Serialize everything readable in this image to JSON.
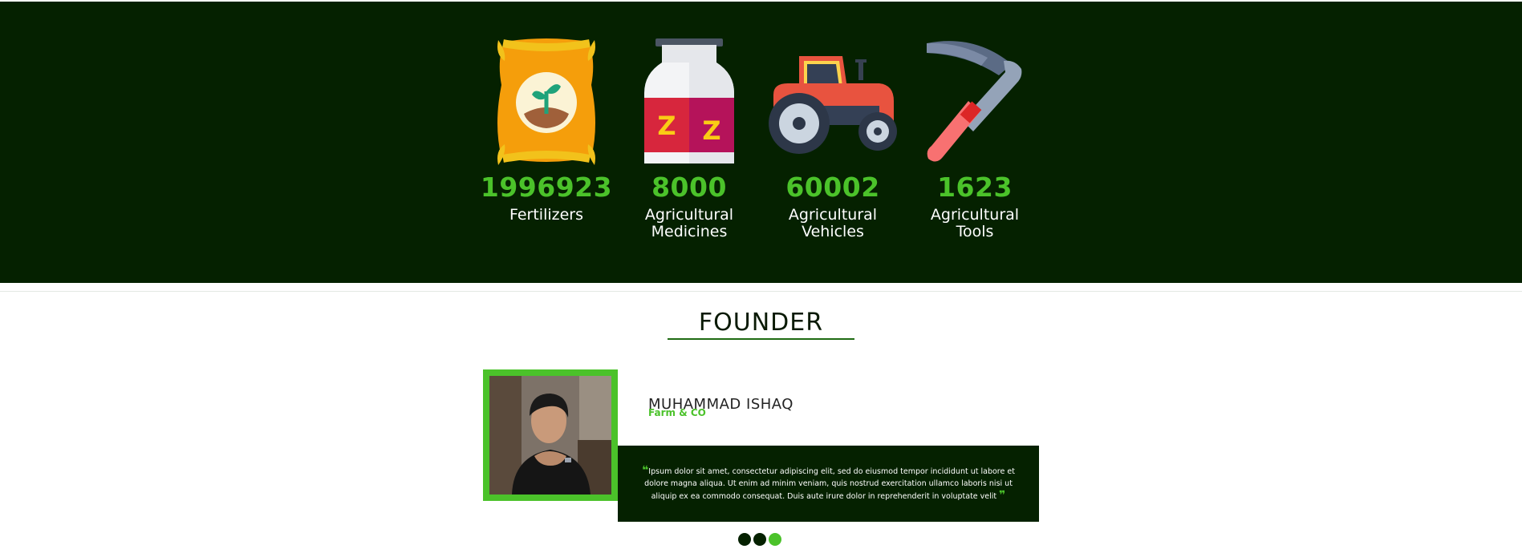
{
  "stats": [
    {
      "number": "1996923",
      "label_line1": "Fertilizers",
      "label_line2": "",
      "icon": "fertilizer-bag-icon"
    },
    {
      "number": "8000",
      "label_line1": "Agricultural",
      "label_line2": "Medicines",
      "icon": "medicine-jar-icon"
    },
    {
      "number": "60002",
      "label_line1": "Agricultural",
      "label_line2": "Vehicles",
      "icon": "tractor-icon"
    },
    {
      "number": "1623",
      "label_line1": "Agricultural",
      "label_line2": "Tools",
      "icon": "pickaxe-icon"
    }
  ],
  "founder": {
    "section_title": "FOUNDER",
    "name": "MUHAMMAD ISHAQ",
    "company": "Farm & CO",
    "quote_open": "❝",
    "quote": "Ipsum dolor sit amet, consectetur adipiscing elit, sed do eiusmod tempor incididunt ut labore et dolore magna aliqua. Ut enim ad minim veniam, quis nostrud exercitation ullamco laboris nisi ut aliquip ex ea commodo consequat. Duis aute irure dolor in reprehenderit in voluptate velit",
    "quote_close": "❞"
  },
  "carousel": {
    "count": 3,
    "active_index": 2
  },
  "colors": {
    "dark_green": "#052100",
    "accent_green": "#4bc22a",
    "white": "#ffffff"
  }
}
